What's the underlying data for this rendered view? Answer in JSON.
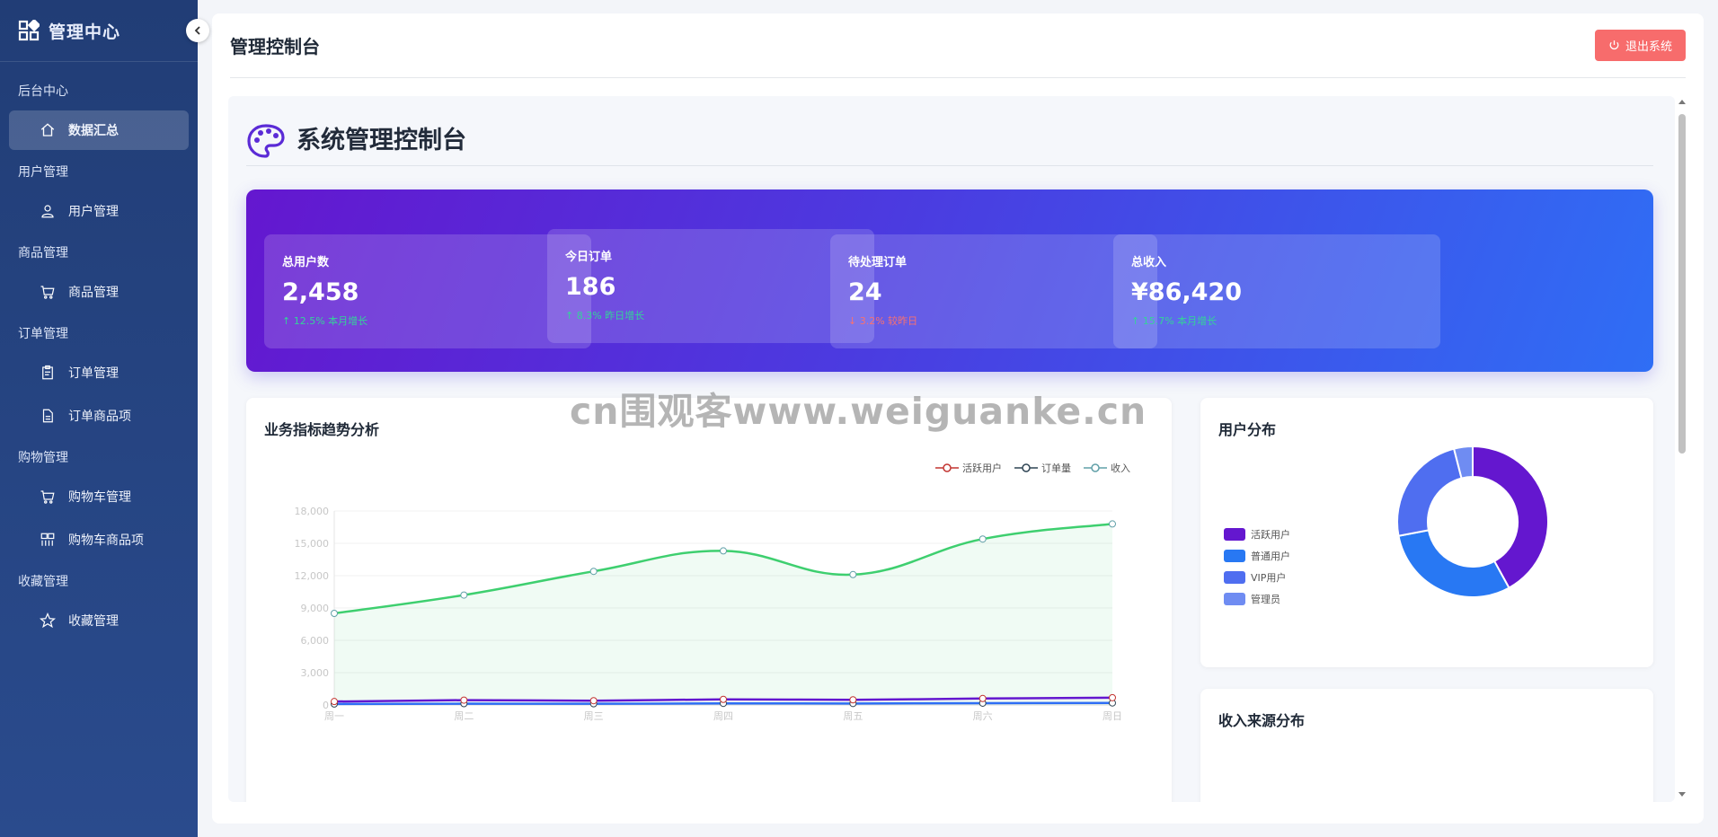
{
  "brand": {
    "title": "管理中心"
  },
  "sidebar": {
    "groups": [
      {
        "title": "后台中心",
        "items": [
          {
            "label": "数据汇总",
            "icon": "home-icon",
            "active": true
          }
        ]
      },
      {
        "title": "用户管理",
        "items": [
          {
            "label": "用户管理",
            "icon": "user-icon"
          }
        ]
      },
      {
        "title": "商品管理",
        "items": [
          {
            "label": "商品管理",
            "icon": "cart-icon"
          }
        ]
      },
      {
        "title": "订单管理",
        "items": [
          {
            "label": "订单管理",
            "icon": "clipboard-icon"
          },
          {
            "label": "订单商品项",
            "icon": "document-icon"
          }
        ]
      },
      {
        "title": "购物管理",
        "items": [
          {
            "label": "购物车管理",
            "icon": "cart-icon"
          },
          {
            "label": "购物车商品项",
            "icon": "grid-icon"
          }
        ]
      },
      {
        "title": "收藏管理",
        "items": [
          {
            "label": "收藏管理",
            "icon": "star-icon"
          }
        ]
      }
    ]
  },
  "header": {
    "title": "管理控制台",
    "logout_label": "退出系统"
  },
  "page": {
    "heading": "系统管理控制台"
  },
  "stats": [
    {
      "label": "总用户数",
      "value": "2,458",
      "trend": "12.5% 本月增长",
      "direction": "up"
    },
    {
      "label": "今日订单",
      "value": "186",
      "trend": "8.3% 昨日增长",
      "direction": "up"
    },
    {
      "label": "待处理订单",
      "value": "24",
      "trend": "3.2% 较昨日",
      "direction": "down"
    },
    {
      "label": "总收入",
      "value": "¥86,420",
      "trend": "15.7% 本月增长",
      "direction": "up"
    }
  ],
  "trend_card": {
    "title": "业务指标趋势分析"
  },
  "pie_card": {
    "title": "用户分布"
  },
  "income_card": {
    "title": "收入来源分布"
  },
  "watermark": "cn围观客www.weiguanke.cn",
  "colors": {
    "sidebar": "#2a4b8d",
    "logout": "#f76c6c",
    "purple": "#6417cf",
    "blue": "#2f6ef5"
  },
  "chart_data": [
    {
      "type": "line",
      "title": "业务指标趋势分析",
      "categories": [
        "周一",
        "周二",
        "周三",
        "周四",
        "周五",
        "周六",
        "周日"
      ],
      "ylim": [
        0,
        18000
      ],
      "yticks": [
        "0",
        "3,000",
        "6,000",
        "9,000",
        "12,000",
        "15,000",
        "18,000"
      ],
      "legend_position": "top-right",
      "series": [
        {
          "name": "活跃用户",
          "color": "#c23531",
          "line_color": "#6417cf",
          "values": [
            320,
            450,
            400,
            520,
            480,
            600,
            680
          ]
        },
        {
          "name": "订单量",
          "color": "#2f4554",
          "line_color": "#2f6ef5",
          "values": [
            90,
            120,
            110,
            150,
            140,
            170,
            190
          ]
        },
        {
          "name": "收入",
          "color": "#61a0a8",
          "line_color": "#3ecf6f",
          "values": [
            8500,
            10200,
            12400,
            14300,
            12100,
            15400,
            16800
          ]
        }
      ]
    },
    {
      "type": "pie",
      "title": "用户分布",
      "legend_position": "left",
      "categories": [
        "活跃用户",
        "普通用户",
        "VIP用户",
        "管理员"
      ],
      "colors": [
        "#6417cf",
        "#2878f3",
        "#4f6ef0",
        "#6f8cf2"
      ],
      "values": [
        42,
        30,
        24,
        4
      ]
    }
  ]
}
